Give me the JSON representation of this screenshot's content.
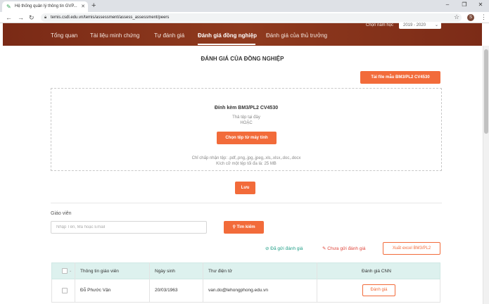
{
  "browser": {
    "tab_title": "Hệ thống quản lý thông tin GVP...",
    "url": "temis.csdl.edu.vn/temis/assessment/assess_assessment/peers",
    "profile_initial": "S"
  },
  "nav": {
    "items": [
      "Tổng quan",
      "Tài liệu minh chứng",
      "Tự đánh giá",
      "Đánh giá đồng nghiệp",
      "Đánh giá của thủ trưởng"
    ],
    "active_index": 3,
    "year_label": "Chọn năm học",
    "year_value": "2019 - 2020"
  },
  "page": {
    "title": "ĐÁNH GIÁ CỦA ĐỒNG NGHIỆP",
    "download_template_button": "Tải file mẫu BM3/PL2 CV4530"
  },
  "upload": {
    "title": "Đính kèm BM3/PL2 CV4530",
    "drop_hint": "Thả tệp tại đây",
    "or_text": "HOẶC",
    "choose_button": "Chọn tệp từ máy tính",
    "accepted_types": "Chỉ chấp nhận tệp: .pdf,.png,.jpg,.jpeg,.xls,.xlsx,.doc,.docx",
    "max_size": "Kích cỡ một tệp tối đa là: 25 MB"
  },
  "save_button": "Lưu",
  "filter": {
    "teacher_label": "Giáo viên",
    "search_placeholder": "Nhập Tên, Mã hoặc Email",
    "search_button": "Tìm kiếm"
  },
  "legend": {
    "sent": "Đã gửi đánh giá",
    "not_sent": "Chưa gửi đánh giá"
  },
  "export_button": "Xuất excel BM3/PL2",
  "table": {
    "headers": [
      "Thông tin giáo viên",
      "Ngày sinh",
      "Thư điện tử",
      "Đánh giá CNN"
    ],
    "rows": [
      {
        "name": "Đỗ Phước Vận",
        "dob": "20/03/1963",
        "email": "van.do@lehongphong.edu.vn",
        "action": "Đánh giá"
      }
    ]
  },
  "colors": {
    "accent": "#f26b3a",
    "header_bg": "#7a2a16",
    "sent": "#1e9e86",
    "not_sent": "#e0453b",
    "table_head": "#ddf1ee"
  }
}
